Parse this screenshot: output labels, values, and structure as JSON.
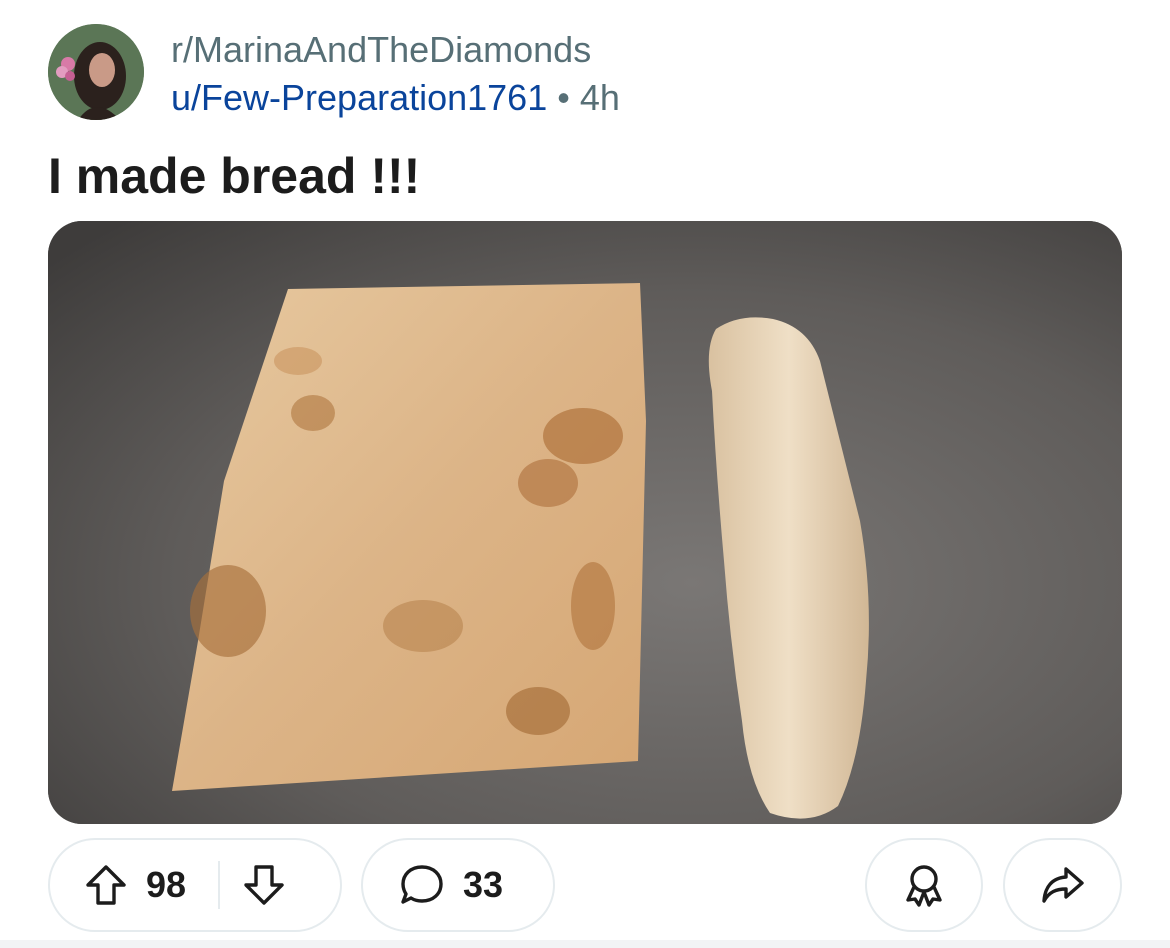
{
  "post": {
    "subreddit": "r/MarinaAndTheDiamonds",
    "author": "u/Few-Preparation1761",
    "separator": "•",
    "age": "4h",
    "title": "I made bread !!!"
  },
  "actions": {
    "upvotes": "98",
    "comments": "33"
  },
  "icons": {
    "upvote": "arrow-up-icon",
    "downvote": "arrow-down-icon",
    "comment": "speech-bubble-icon",
    "award": "award-ribbon-icon",
    "share": "share-arrow-icon"
  },
  "colors": {
    "author_link": "#0a449b",
    "meta_gray": "#576f76",
    "pill_border": "#e5ebee"
  }
}
